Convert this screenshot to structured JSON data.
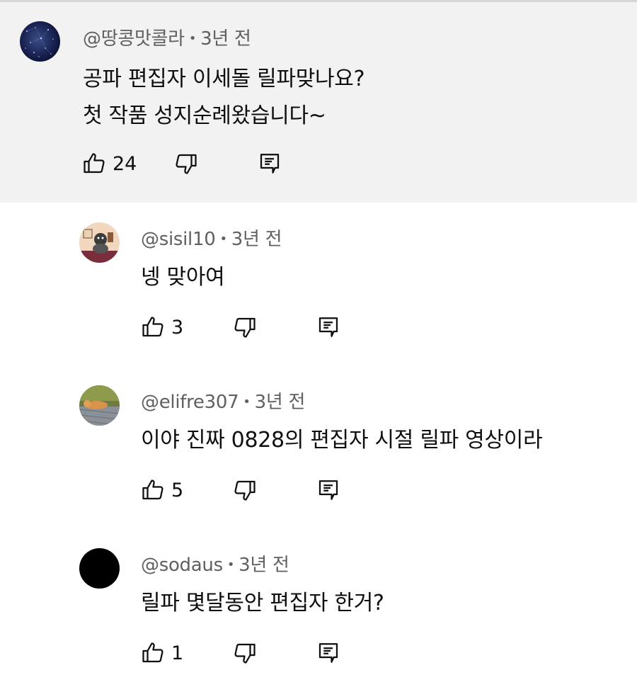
{
  "comments": [
    {
      "author": "@땅콩맛콜라",
      "age": "3년 전",
      "lines": [
        "공파 편집자 이세돌 릴파맞나요?",
        "첫 작품 성지순례왔습니다~"
      ],
      "likes": "24",
      "avatar": "galaxy"
    },
    {
      "author": "@sisil10",
      "age": "3년 전",
      "lines": [
        "넹 맞아여"
      ],
      "likes": "3",
      "avatar": "dog-cartoon"
    },
    {
      "author": "@elifre307",
      "age": "3년 전",
      "lines": [
        "이야 진짜 0828의 편집자 시절 릴파 영상이라"
      ],
      "likes": "5",
      "avatar": "cat-photo"
    },
    {
      "author": "@sodaus",
      "age": "3년 전",
      "lines": [
        "릴파 몇달동안 편집자 한거?"
      ],
      "likes": "1",
      "avatar": "black"
    }
  ],
  "icons": {
    "like": "thumb-up-icon",
    "dislike": "thumb-down-icon",
    "reply": "reply-icon"
  },
  "colors": {
    "highlight_bg": "#f2f2f2",
    "meta_text": "#606060",
    "body_text": "#0f0f0f"
  }
}
